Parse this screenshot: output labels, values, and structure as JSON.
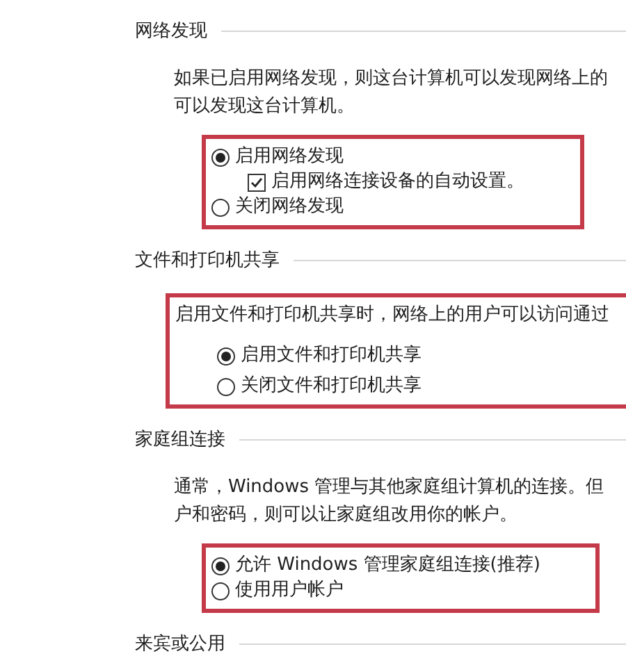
{
  "sections": [
    {
      "heading": "网络发现",
      "description": [
        "如果已启用网络发现，则这台计算机可以发现网络上的",
        "可以发现这台计算机。"
      ],
      "highlighted": true,
      "highlight_covers_description": false,
      "options": [
        {
          "kind": "radio",
          "label": "启用网络发现",
          "selected": true
        },
        {
          "kind": "checkbox",
          "label": "启用网络连接设备的自动设置。",
          "checked": true
        },
        {
          "kind": "radio",
          "label": "关闭网络发现",
          "selected": false
        }
      ]
    },
    {
      "heading": "文件和打印机共享",
      "description": [
        "启用文件和打印机共享时，网络上的用户可以访问通过"
      ],
      "highlighted": true,
      "highlight_covers_description": true,
      "options": [
        {
          "kind": "radio",
          "label": "启用文件和打印机共享",
          "selected": true
        },
        {
          "kind": "radio",
          "label": "关闭文件和打印机共享",
          "selected": false
        }
      ]
    },
    {
      "heading": "家庭组连接",
      "description": [
        "通常，Windows 管理与其他家庭组计算机的连接。但",
        "户和密码，则可以让家庭组改用你的帐户。"
      ],
      "highlighted": true,
      "highlight_covers_description": false,
      "options": [
        {
          "kind": "radio",
          "label": "允许 Windows 管理家庭组连接(推荐)",
          "selected": true
        },
        {
          "kind": "radio",
          "label": "使用用户帐户",
          "selected": false
        }
      ]
    },
    {
      "heading": "来宾或公用"
    }
  ]
}
